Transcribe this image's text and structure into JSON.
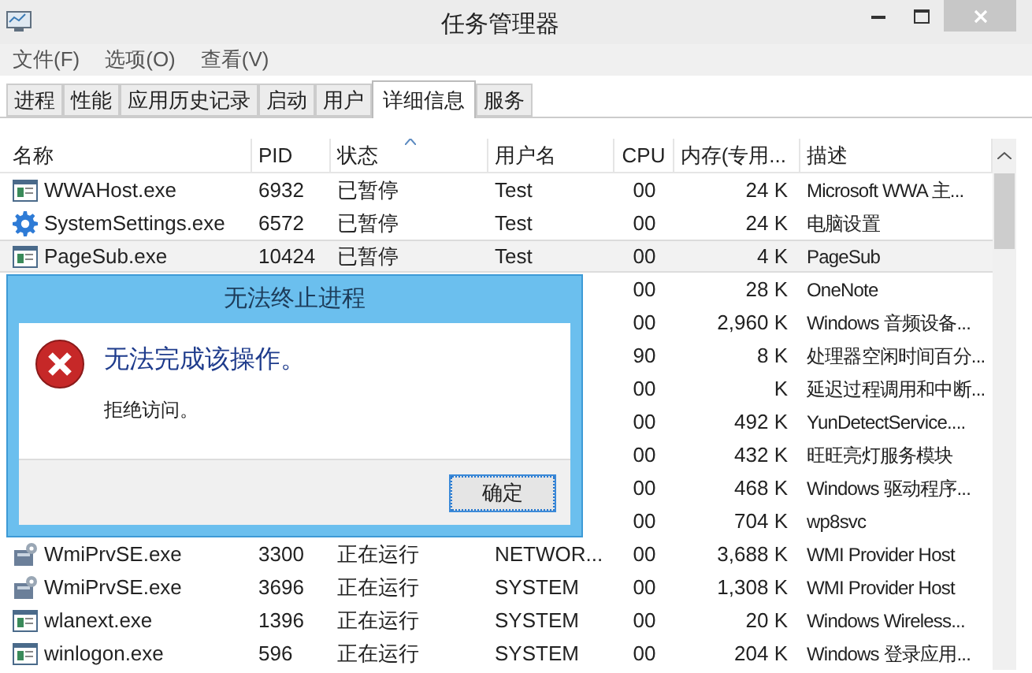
{
  "window": {
    "title": "任务管理器"
  },
  "menu": [
    "文件(F)",
    "选项(O)",
    "查看(V)"
  ],
  "tabs": [
    {
      "label": "进程",
      "selected": false
    },
    {
      "label": "性能",
      "selected": false
    },
    {
      "label": "应用历史记录",
      "selected": false
    },
    {
      "label": "启动",
      "selected": false
    },
    {
      "label": "用户",
      "selected": false
    },
    {
      "label": "详细信息",
      "selected": true
    },
    {
      "label": "服务",
      "selected": false
    }
  ],
  "table": {
    "columns": [
      "名称",
      "PID",
      "状态",
      "用户名",
      "CPU",
      "内存(专用...",
      "描述"
    ],
    "rows": [
      {
        "kind": "app",
        "name": "WWAHost.exe",
        "pid": "6932",
        "status": "已暂停",
        "user": "Test",
        "cpu": "00",
        "mem": "24 K",
        "desc": "Microsoft WWA 主...",
        "selected": false
      },
      {
        "kind": "gear",
        "name": "SystemSettings.exe",
        "pid": "6572",
        "status": "已暂停",
        "user": "Test",
        "cpu": "00",
        "mem": "24 K",
        "desc": "电脑设置",
        "selected": false
      },
      {
        "kind": "app",
        "name": "PageSub.exe",
        "pid": "10424",
        "status": "已暂停",
        "user": "Test",
        "cpu": "00",
        "mem": "4 K",
        "desc": "PageSub",
        "selected": true
      },
      {
        "cpu": "00",
        "mem": "28 K",
        "desc": "OneNote",
        "selected": false
      },
      {
        "cpu": "00",
        "mem": "2,960 K",
        "desc": "Windows 音频设备...",
        "selected": false
      },
      {
        "cpu": "90",
        "mem": "8 K",
        "desc": "处理器空闲时间百分...",
        "selected": false
      },
      {
        "cpu": "00",
        "mem": "K",
        "desc": "延迟过程调用和中断...",
        "selected": false
      },
      {
        "cpu": "00",
        "mem": "492 K",
        "desc": "YunDetectService....",
        "selected": false
      },
      {
        "cpu": "00",
        "mem": "432 K",
        "desc": "旺旺亮灯服务模块",
        "selected": false
      },
      {
        "cpu": "00",
        "mem": "468 K",
        "desc": "Windows 驱动程序...",
        "selected": false
      },
      {
        "cpu": "00",
        "mem": "704 K",
        "desc": "wp8svc",
        "selected": false
      },
      {
        "kind": "service",
        "name": "WmiPrvSE.exe",
        "pid": "3300",
        "status": "正在运行",
        "user": "NETWOR...",
        "cpu": "00",
        "mem": "3,688 K",
        "desc": "WMI Provider Host",
        "selected": false
      },
      {
        "kind": "service",
        "name": "WmiPrvSE.exe",
        "pid": "3696",
        "status": "正在运行",
        "user": "SYSTEM",
        "cpu": "00",
        "mem": "1,308 K",
        "desc": "WMI Provider Host",
        "selected": false
      },
      {
        "kind": "app",
        "name": "wlanext.exe",
        "pid": "1396",
        "status": "正在运行",
        "user": "SYSTEM",
        "cpu": "00",
        "mem": "20 K",
        "desc": "Windows Wireless...",
        "selected": false
      },
      {
        "kind": "app",
        "name": "winlogon.exe",
        "pid": "596",
        "status": "正在运行",
        "user": "SYSTEM",
        "cpu": "00",
        "mem": "204 K",
        "desc": "Windows 登录应用...",
        "selected": false
      }
    ]
  },
  "dialog": {
    "title": "无法终止进程",
    "heading": "无法完成该操作。",
    "message": "拒绝访问。",
    "button": "确定"
  }
}
